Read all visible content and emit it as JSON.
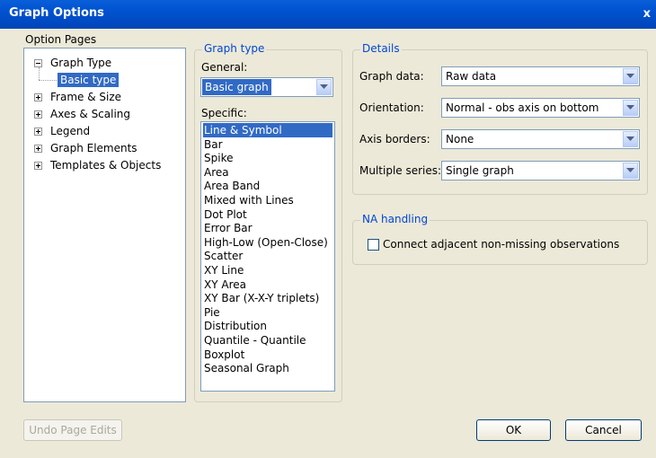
{
  "window": {
    "title": "Graph Options",
    "close_glyph": "x"
  },
  "option_pages": {
    "label": "Option Pages",
    "items": [
      {
        "label": "Graph Type",
        "expanded": true,
        "children": [
          {
            "label": "Basic type",
            "selected": true
          }
        ]
      },
      {
        "label": "Frame & Size",
        "expanded": false
      },
      {
        "label": "Axes & Scaling",
        "expanded": false
      },
      {
        "label": "Legend",
        "expanded": false
      },
      {
        "label": "Graph Elements",
        "expanded": false
      },
      {
        "label": "Templates & Objects",
        "expanded": false
      }
    ]
  },
  "graph_type": {
    "legend": "Graph type",
    "general_label": "General:",
    "general_value": "Basic graph",
    "specific_label": "Specific:",
    "specific_items": [
      "Line & Symbol",
      "Bar",
      "Spike",
      "Area",
      "Area Band",
      "Mixed with Lines",
      "Dot Plot",
      "Error Bar",
      "High-Low (Open-Close)",
      "Scatter",
      "XY Line",
      "XY Area",
      "XY Bar (X-X-Y triplets)",
      "Pie",
      "Distribution",
      "Quantile - Quantile",
      "Boxplot",
      "Seasonal Graph"
    ],
    "selected_index": 0
  },
  "details": {
    "legend": "Details",
    "rows": [
      {
        "label": "Graph data:",
        "value": "Raw data"
      },
      {
        "label": "Orientation:",
        "value": "Normal - obs axis on bottom"
      },
      {
        "label": "Axis borders:",
        "value": "None"
      },
      {
        "label": "Multiple series:",
        "value": "Single graph"
      }
    ]
  },
  "na_handling": {
    "legend": "NA handling",
    "checkbox_label": "Connect adjacent non-missing observations",
    "checked": false
  },
  "buttons": {
    "undo": "Undo Page Edits",
    "ok": "OK",
    "cancel": "Cancel"
  },
  "colors": {
    "title_bar": "#0052d0",
    "selection": "#316ac5",
    "group_legend": "#0046d5",
    "face": "#ece9d8"
  }
}
